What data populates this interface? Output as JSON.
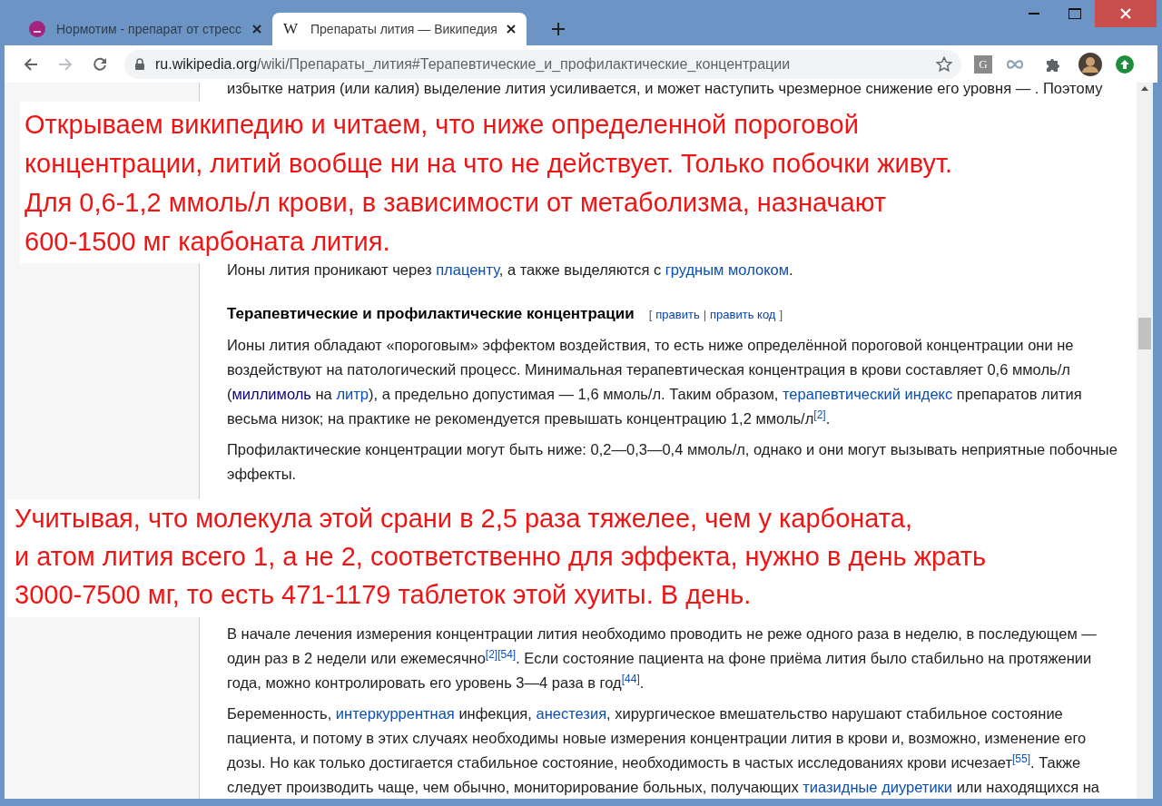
{
  "tabs": [
    {
      "title": "Нормотим - препарат от стресс",
      "selected": false,
      "favicon": {
        "kind": "circle"
      }
    },
    {
      "title": "Препараты лития — Википедия",
      "selected": true,
      "favicon": {
        "kind": "letter",
        "text": "W"
      }
    }
  ],
  "address_bar": {
    "host": "ru.wikipedia.org",
    "path": "/wiki/Препараты_лития#Терапевтические_и_профилактические_концентрации"
  },
  "extensions": [
    {
      "kind": "letter",
      "text": "G"
    },
    {
      "kind": "infinity"
    },
    {
      "kind": "puzzle"
    },
    {
      "kind": "avatar"
    },
    {
      "kind": "update"
    }
  ],
  "article": {
    "cut_line": "избытке натрия (или калия) выделение лития усиливается, и может наступить чрезмерное снижение его уровня — . Поэтому",
    "blocks": [
      {
        "kind": "paragraph",
        "segments": [
          {
            "kind": "text",
            "text": "Ионы лития проникают через "
          },
          {
            "kind": "link",
            "text": "плаценту"
          },
          {
            "kind": "text",
            "text": ", а также выделяются с "
          },
          {
            "kind": "link",
            "text": "грудным молоком"
          },
          {
            "kind": "text",
            "text": "."
          }
        ]
      },
      {
        "kind": "heading",
        "text": "Терапевтические и профилактические концентрации",
        "edit_links": [
          "править",
          "править код"
        ],
        "brackets": [
          "[",
          "]"
        ],
        "separator": "|"
      },
      {
        "kind": "paragraph",
        "segments": [
          {
            "kind": "text",
            "text": "Ионы лития обладают «пороговым» эффектом воздействия, то есть ниже определённой пороговой концентрации они не воздействуют на патологический процесс. Минимальная терапевтическая концентрация в крови составляет 0,6 ммоль/л ("
          },
          {
            "kind": "link",
            "text": "миллимоль",
            "visited": true
          },
          {
            "kind": "text",
            "text": " на "
          },
          {
            "kind": "link",
            "text": "литр"
          },
          {
            "kind": "text",
            "text": "), а предельно допустимая — 1,6 ммоль/л. Таким образом, "
          },
          {
            "kind": "link",
            "text": "терапевтический индекс"
          },
          {
            "kind": "text",
            "text": " препаратов лития весьма низок; на практике не рекомендуется превышать концентрацию 1,2 ммоль/л"
          },
          {
            "kind": "ref",
            "text": "[2]"
          },
          {
            "kind": "text",
            "text": "."
          }
        ]
      },
      {
        "kind": "paragraph",
        "segments": [
          {
            "kind": "text",
            "text": "Профилактические концентрации могут быть ниже: 0,2—0,3—0,4 ммоль/л, однако и они могут вызывать неприятные побочные эффекты."
          }
        ]
      },
      {
        "kind": "gap"
      },
      {
        "kind": "paragraph",
        "segments": [
          {
            "kind": "text",
            "text": "В начале лечения измерения концентрации лития необходимо проводить не реже одного раза в неделю, в последующем — один раз в 2 недели или ежемесячно"
          },
          {
            "kind": "ref",
            "text": "[2]"
          },
          {
            "kind": "ref",
            "text": "[54]"
          },
          {
            "kind": "text",
            "text": ". Если состояние пациента на фоне приёма лития было стабильно на протяжении года, можно контролировать его уровень 3—4 раза в год"
          },
          {
            "kind": "ref",
            "text": "[44]"
          },
          {
            "kind": "text",
            "text": "."
          }
        ]
      },
      {
        "kind": "paragraph",
        "segments": [
          {
            "kind": "text",
            "text": "Беременность, "
          },
          {
            "kind": "link",
            "text": "интеркуррентная"
          },
          {
            "kind": "text",
            "text": " инфекция, "
          },
          {
            "kind": "link",
            "text": "анестезия"
          },
          {
            "kind": "text",
            "text": ", хирургическое вмешательство нарушают стабильное состояние пациента, и потому в этих случаях необходимы новые измерения концентрации лития в крови и, возможно, изменение его дозы. Но как только достигается стабильное состояние, необходимость в частых исследованиях крови исчезает"
          },
          {
            "kind": "ref",
            "text": "[55]"
          },
          {
            "kind": "text",
            "text": ". Также следует производить чаще, чем обычно, мониторирование больных, получающих "
          },
          {
            "kind": "link",
            "text": "тиазидные диуретики"
          },
          {
            "kind": "text",
            "text": " или находящихся на"
          }
        ]
      }
    ]
  },
  "annotations": [
    {
      "lines": [
        "Открываем википедию и читаем, что ниже определенной пороговой",
        "концентрации, литий вообще ни на что не действует. Только побочки живут.",
        "Для 0,6-1,2 ммоль/л крови, в зависимости от метаболизма, назначают",
        "600-1500 мг карбоната лития."
      ]
    },
    {
      "lines": [
        "Учитывая, что молекула этой срани в 2,5 раза тяжелее, чем у карбоната,",
        "и атом лития всего 1, а не 2, соответственно для эффекта, нужно в день жрать",
        "3000-7500 мг, то есть 471-1179 таблеток этой хуиты. В день."
      ]
    }
  ]
}
